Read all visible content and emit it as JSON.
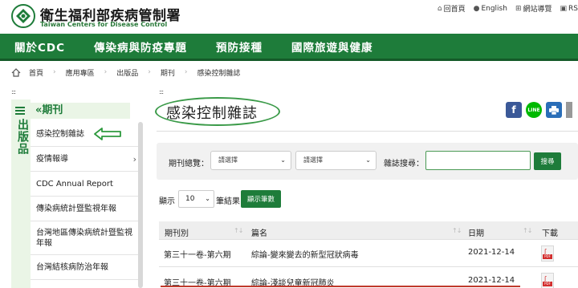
{
  "header": {
    "org_cn": "衛生福利部疾病管制署",
    "org_en": "Taiwan Centers for Disease Control",
    "top_links": [
      {
        "label": "回首頁",
        "icon": "home-icon"
      },
      {
        "label": "English",
        "icon": "globe-icon"
      },
      {
        "label": "網站導覽",
        "icon": "sitemap-icon"
      },
      {
        "label": "RS",
        "icon": "rss-icon"
      }
    ]
  },
  "nav": [
    "關於CDC",
    "傳染病與防疫專題",
    "預防接種",
    "國際旅遊與健康"
  ],
  "breadcrumb": [
    "首頁",
    "應用專區",
    "出版品",
    "期刊",
    "感染控制雜誌"
  ],
  "sidebar": {
    "vertical_label": "出版品",
    "header": "«期刊",
    "items": [
      {
        "label": "感染控制雜誌"
      },
      {
        "label": "疫情報導",
        "chevron": "›"
      },
      {
        "label": "CDC Annual Report"
      },
      {
        "label": "傳染病統計暨監視年報"
      },
      {
        "label": "台灣地區傳染病統計暨監視年報"
      },
      {
        "label": "台灣結核病防治年報"
      }
    ]
  },
  "main": {
    "title": "感染控制雜誌",
    "filter": {
      "period_label": "期刊總覽：",
      "select1": "請選擇",
      "select2": "請選擇",
      "search_label": "雜誌搜尋：",
      "search_value": "",
      "search_button": "搜尋"
    },
    "show": {
      "prefix": "顯示",
      "value": "10",
      "suffix": "筆結果",
      "button": "顯示筆數"
    },
    "table": {
      "headers": [
        "期刊別",
        "篇名",
        "日期",
        "下載"
      ],
      "rows": [
        {
          "issue": "第三十一卷-第六期",
          "title": "綜論-變來變去的新型冠狀病毒",
          "date": "2021-12-14",
          "download": "PDF"
        },
        {
          "issue": "第三十一卷-第六期",
          "title": "綜論-淺談兒童新冠肺炎",
          "date": "2021-12-14",
          "download": "PDF"
        }
      ]
    }
  },
  "colors": {
    "brand_green": "#1e7c3a",
    "sidebar_tint": "#eaf5e6",
    "facebook": "#3b5998",
    "line": "#00b900",
    "print": "#2a6eb8"
  }
}
